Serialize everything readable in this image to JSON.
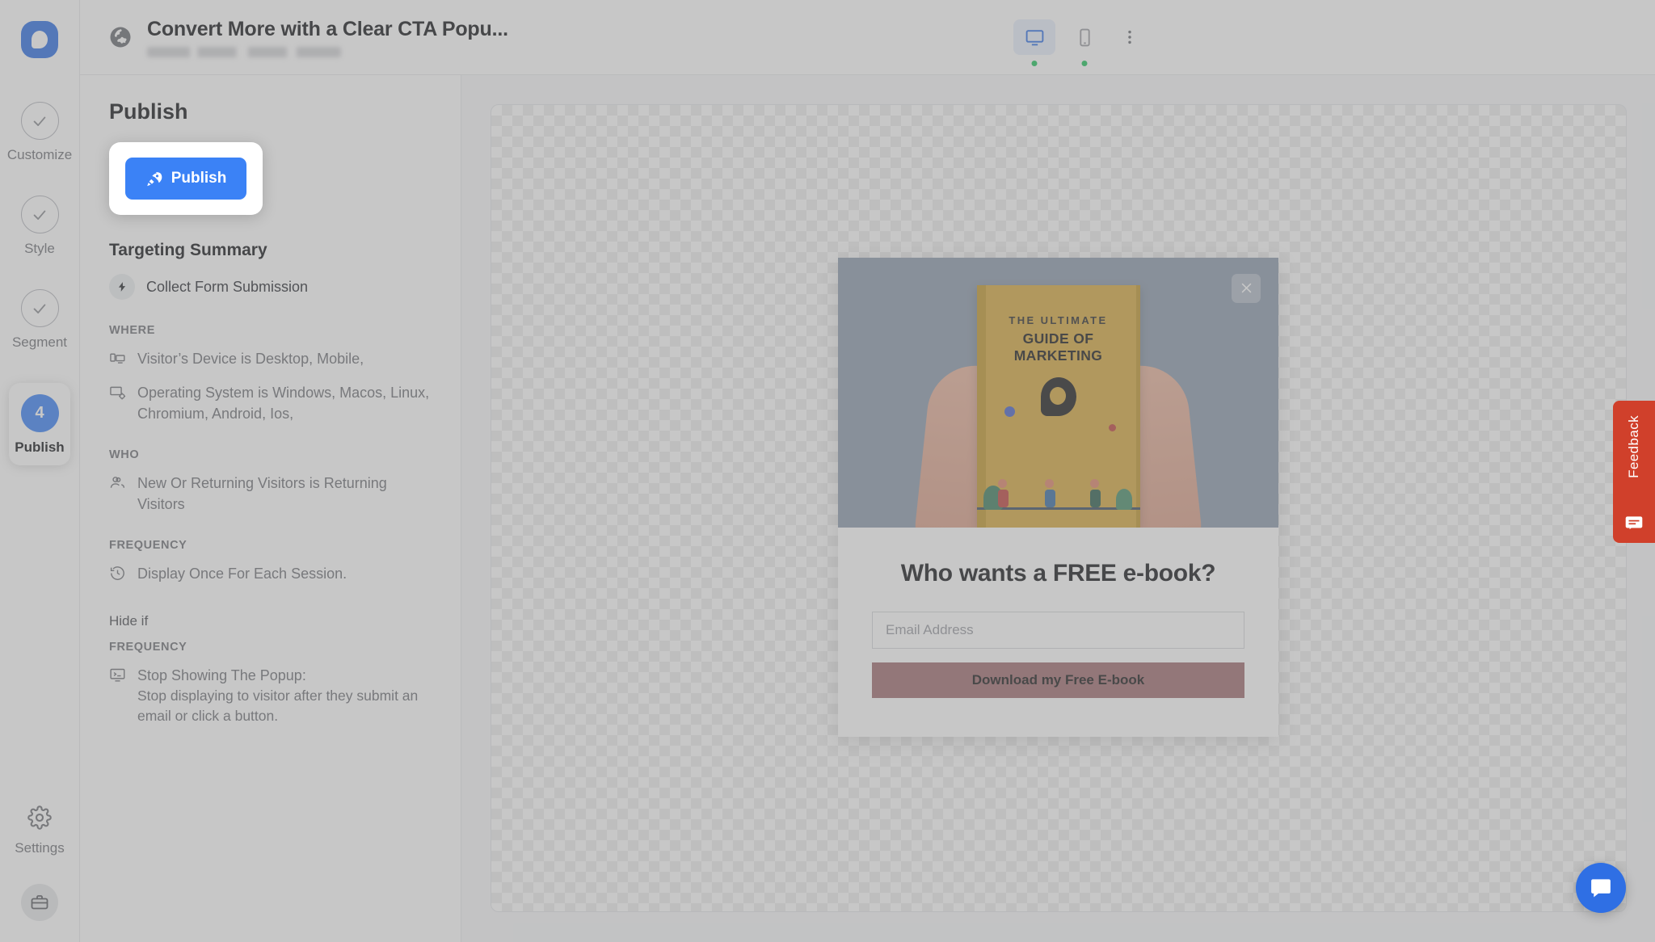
{
  "app": {
    "logo_icon": "popupsmart-logo-icon"
  },
  "header": {
    "site_icon": "globe-icon",
    "title": "Convert More with a Clear CTA Popu...",
    "devices": [
      {
        "name": "desktop",
        "icon": "desktop-icon",
        "selected": true,
        "status_dot": true
      },
      {
        "name": "mobile",
        "icon": "mobile-icon",
        "selected": false,
        "status_dot": true
      }
    ],
    "more_icon": "kebab-menu-icon"
  },
  "rail": {
    "steps": [
      {
        "label": "Customize",
        "state": "complete",
        "icon": "check-icon"
      },
      {
        "label": "Style",
        "state": "complete",
        "icon": "check-icon"
      },
      {
        "label": "Segment",
        "state": "complete",
        "icon": "check-icon"
      },
      {
        "label": "Publish",
        "state": "active",
        "number": "4"
      }
    ],
    "settings": {
      "label": "Settings",
      "icon": "gear-icon"
    },
    "toolbox": {
      "icon": "toolbox-icon"
    }
  },
  "panel": {
    "heading": "Publish",
    "publish_button": {
      "label": "Publish",
      "icon": "rocket-icon"
    },
    "targeting_heading": "Targeting Summary",
    "goal": {
      "label": "Collect Form Submission",
      "icon": "bolt-icon"
    },
    "sections": [
      {
        "label": "WHERE",
        "rules": [
          {
            "icon": "devices-icon",
            "text": "Visitor’s Device is Desktop, Mobile,"
          },
          {
            "icon": "os-icon",
            "text": "Operating System is Windows, Macos, Linux, Chromium, Android, Ios,"
          }
        ]
      },
      {
        "label": "WHO",
        "rules": [
          {
            "icon": "visitors-icon",
            "text": "New Or Returning Visitors is Returning Visitors"
          }
        ]
      },
      {
        "label": "FREQUENCY",
        "rules": [
          {
            "icon": "history-icon",
            "text": "Display Once For Each Session."
          }
        ]
      }
    ],
    "hide_if": {
      "heading": "Hide if",
      "frequency_label": "FREQUENCY",
      "rule": {
        "icon": "stop-popup-icon",
        "title": "Stop Showing The Popup:",
        "description": "Stop displaying to visitor after they submit an email or click a button."
      }
    }
  },
  "preview": {
    "close_icon": "close-icon",
    "book": {
      "line1": "THE ULTIMATE",
      "line2": "GUIDE OF MARKETING",
      "logo_icon": "popupsmart-logo-icon"
    },
    "headline": "Who wants a FREE e-book?",
    "email_placeholder": "Email Address",
    "email_value": "",
    "cta_label": "Download my Free E-book"
  },
  "feedback": {
    "label": "Feedback",
    "icon": "feedback-icon"
  },
  "chat": {
    "icon": "intercom-chat-icon"
  },
  "colors": {
    "brand_blue": "#2f6fe4",
    "publish_blue": "#3b82f6",
    "status_green": "#22c55e",
    "cta_rose": "#a06d72",
    "book_gold": "#d8a941",
    "feedback_red": "#d0402b"
  }
}
